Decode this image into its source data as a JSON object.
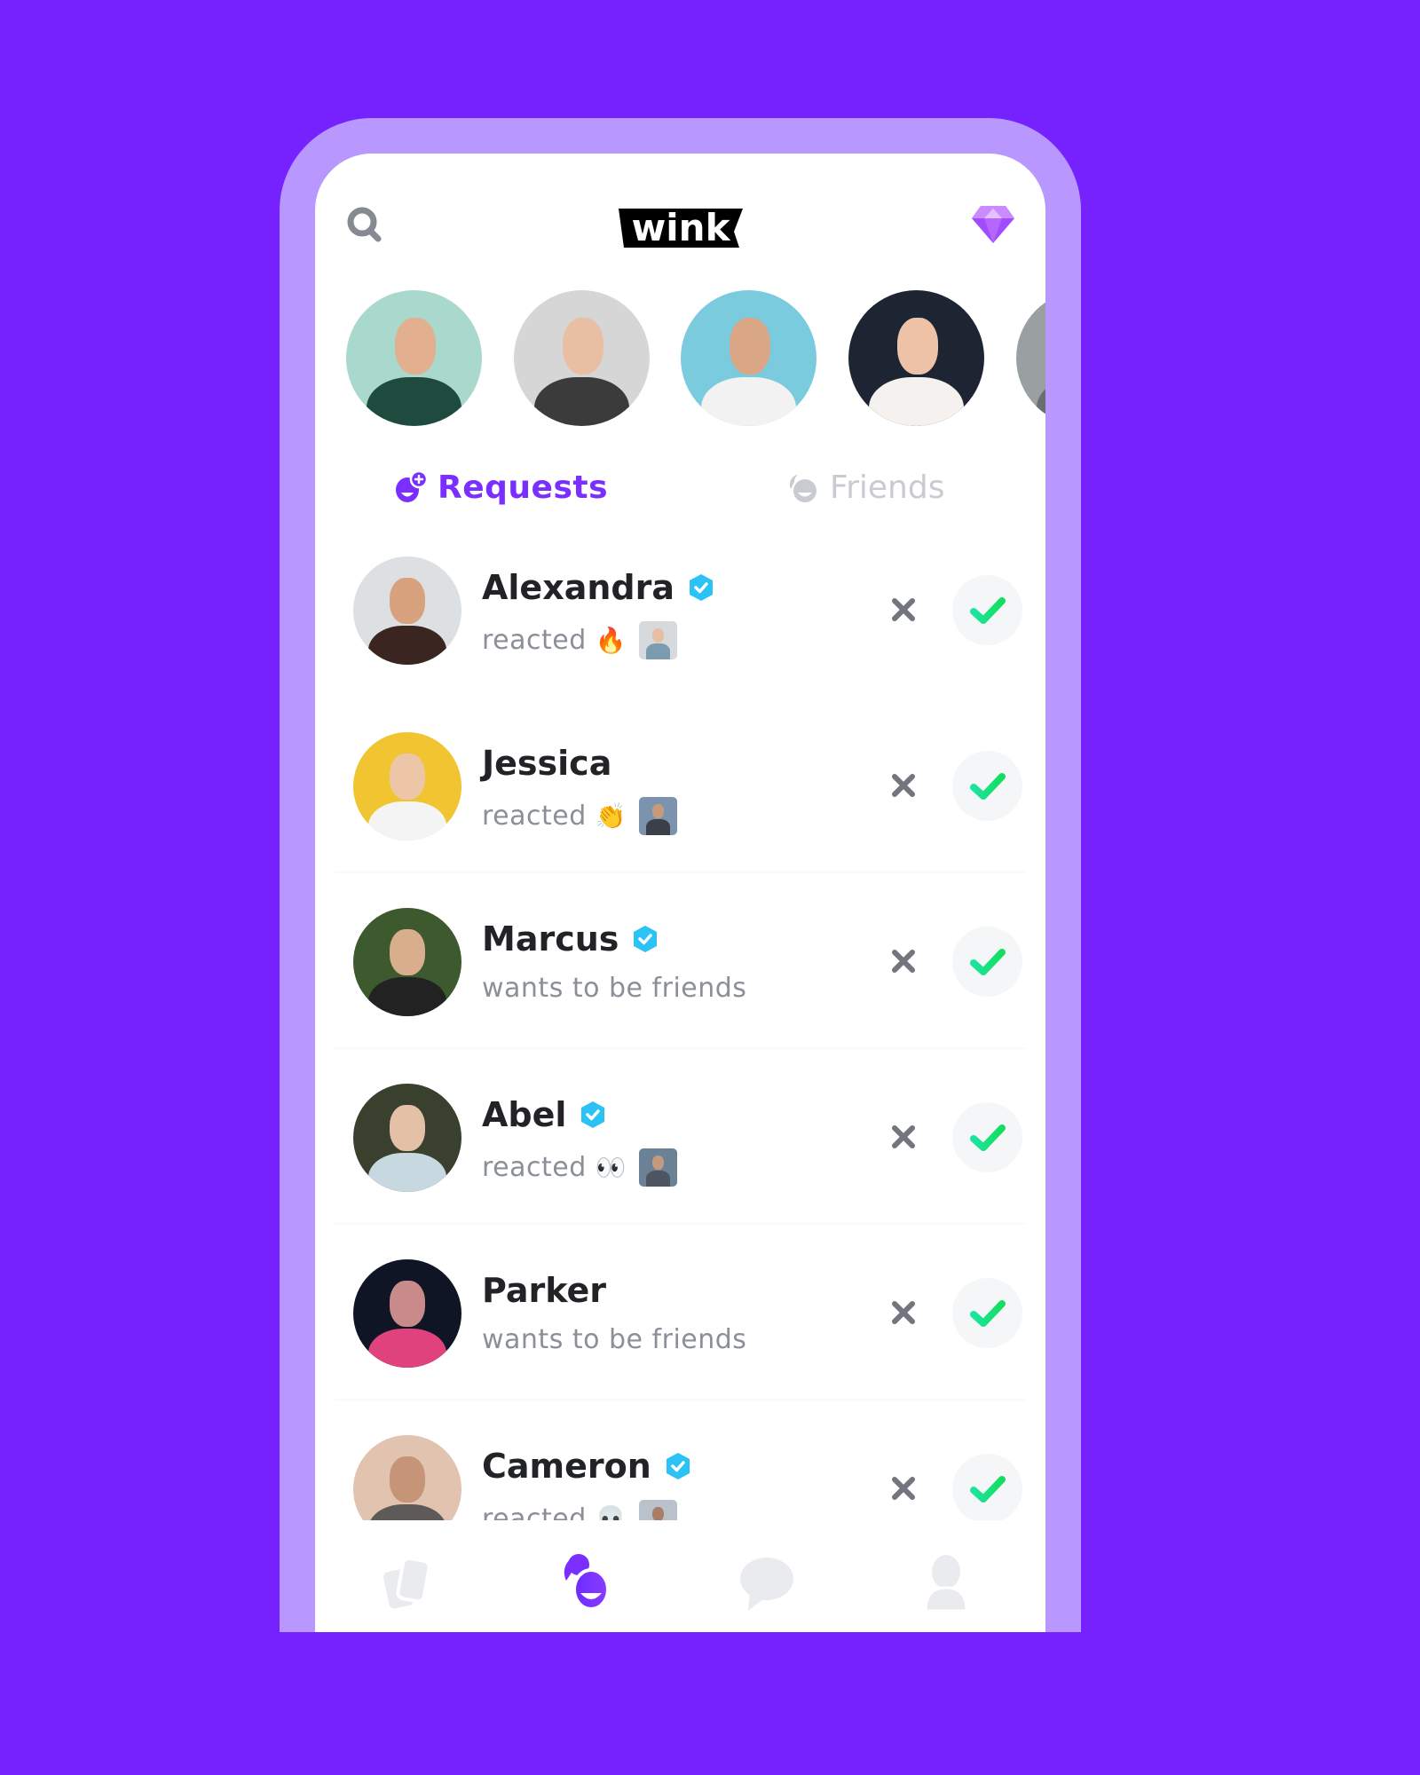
{
  "app": {
    "name": "wink",
    "colors": {
      "background": "#7522FF",
      "frame": "#B897FF",
      "accent": "#7A2EFF",
      "accept_green": "#18E07E",
      "verified_blue": "#2BC2F5",
      "muted_icon": "#E8EAEE"
    }
  },
  "header": {
    "logo_text": "wink",
    "search_icon": "search-icon",
    "premium_icon": "diamond-icon"
  },
  "stories": [
    {
      "name": "story-1",
      "bg": "#A9D8CC",
      "skin": "#E2B08E",
      "shirt": "#1F4A3E"
    },
    {
      "name": "story-2",
      "bg": "#D6D6D6",
      "skin": "#E8BFA2",
      "shirt": "#3B3B3B"
    },
    {
      "name": "story-3",
      "bg": "#7ACBDD",
      "skin": "#D9A785",
      "shirt": "#F2F2F2"
    },
    {
      "name": "story-4",
      "bg": "#1E2532",
      "skin": "#EDC2A6",
      "shirt": "#F4F1EE"
    },
    {
      "name": "story-5",
      "bg": "#9AA0A2",
      "skin": "#8C8C8C",
      "shirt": "#6A6E70"
    }
  ],
  "tabs": [
    {
      "label": "Requests",
      "icon": "add-friend-icon",
      "active": true
    },
    {
      "label": "Friends",
      "icon": "friends-icon",
      "active": false
    }
  ],
  "requests": [
    {
      "name": "Alexandra",
      "verified": true,
      "subtitle": "reacted",
      "emoji": "🔥",
      "has_thumb": true,
      "avatar": {
        "bg": "#DCE0E2",
        "skin": "#D8A27E",
        "body": "#3A2520"
      },
      "thumb": {
        "bg": "#D7DADC",
        "skin": "#E6BFA3",
        "body": "#7A9BB0"
      }
    },
    {
      "name": "Jessica",
      "verified": false,
      "subtitle": "reacted",
      "emoji": "👏",
      "has_thumb": true,
      "avatar": {
        "bg": "#F1C531",
        "skin": "#EDC6A8",
        "body": "#F4F4F4"
      },
      "thumb": {
        "bg": "#7C93AE",
        "skin": "#C69B7B",
        "body": "#3A3F48"
      }
    },
    {
      "name": "Marcus",
      "verified": true,
      "subtitle": "wants to be friends",
      "emoji": "",
      "has_thumb": false,
      "avatar": {
        "bg": "#3D5A2E",
        "skin": "#D9AE8C",
        "body": "#222222"
      },
      "thumb": null
    },
    {
      "name": "Abel",
      "verified": true,
      "subtitle": "reacted",
      "emoji": "👀",
      "has_thumb": true,
      "avatar": {
        "bg": "#39402E",
        "skin": "#E3C0A6",
        "body": "#C8D8E0"
      },
      "thumb": {
        "bg": "#6A8196",
        "skin": "#C39A7E",
        "body": "#4C5560"
      }
    },
    {
      "name": "Parker",
      "verified": false,
      "subtitle": "wants to be friends",
      "emoji": "",
      "has_thumb": false,
      "avatar": {
        "bg": "#101525",
        "skin": "#C98A8A",
        "body": "#E0427E"
      },
      "thumb": null
    },
    {
      "name": "Cameron",
      "verified": true,
      "subtitle": "reacted",
      "emoji": "💀",
      "has_thumb": true,
      "avatar": {
        "bg": "#E2C3B0",
        "skin": "#C69578",
        "body": "#5E5A58"
      },
      "thumb": {
        "bg": "#B9C2CA",
        "skin": "#A87E66",
        "body": "#2F3339"
      }
    }
  ],
  "actions": {
    "decline_icon": "close-icon",
    "accept_icon": "check-icon"
  },
  "bottom_nav": [
    {
      "name": "cards",
      "icon": "cards-icon",
      "active": false
    },
    {
      "name": "friends",
      "icon": "friends-icon",
      "active": true
    },
    {
      "name": "chat",
      "icon": "chat-bubble-icon",
      "active": false
    },
    {
      "name": "profile",
      "icon": "profile-icon",
      "active": false
    }
  ]
}
